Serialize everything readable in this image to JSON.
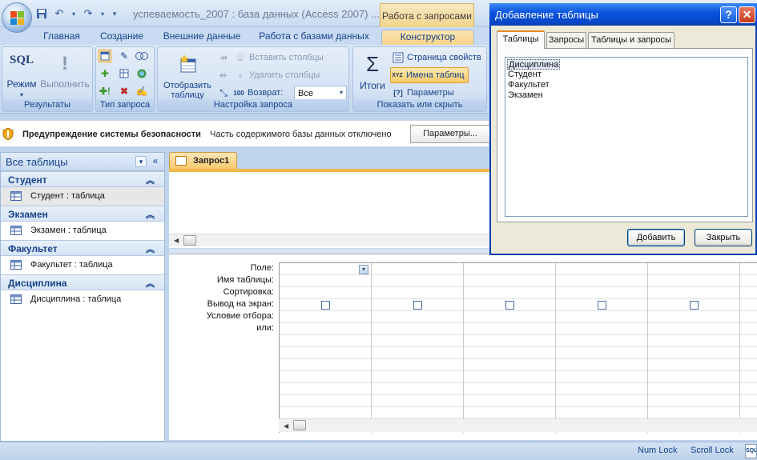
{
  "app": {
    "title": "успеваемость_2007 : база данных (Access 2007) ...!",
    "context_tab_header": "Работа с запросами"
  },
  "tabs": [
    {
      "label": "Главная"
    },
    {
      "label": "Создание"
    },
    {
      "label": "Внешние данные"
    },
    {
      "label": "Работа с базами данных"
    },
    {
      "label": "Конструктор",
      "active": true
    }
  ],
  "ribbon": {
    "results": {
      "label": "Результаты",
      "sql_icon_text": "SQL",
      "view": "Режим",
      "run": "Выполнить"
    },
    "query_type": {
      "label": "Тип запроса"
    },
    "query_setup": {
      "label": "Настройка запроса",
      "show_table": "Отобразить таблицу",
      "insert_columns": "Вставить столбцы",
      "delete_columns": "Удалить столбцы",
      "return_label": "Возврат:",
      "return_value": "Все"
    },
    "show_hide": {
      "label": "Показать или скрыть",
      "totals": "Итоги",
      "property_sheet": "Страница свойств",
      "table_names": "Имена таблиц",
      "parameters": "Параметры",
      "xyz": "XYZ"
    }
  },
  "security_bar": {
    "warning": "Предупреждение системы безопасности",
    "message": "Часть содержимого базы данных отключено",
    "button": "Параметры..."
  },
  "nav_pane": {
    "title": "Все таблицы",
    "groups": [
      {
        "name": "Студент",
        "items": [
          {
            "label": "Студент : таблица",
            "selected": true
          }
        ]
      },
      {
        "name": "Экзамен",
        "items": [
          {
            "label": "Экзамен : таблица"
          }
        ]
      },
      {
        "name": "Факультет",
        "items": [
          {
            "label": "Факультет : таблица"
          }
        ]
      },
      {
        "name": "Дисциплина",
        "items": [
          {
            "label": "Дисциплина : таблица"
          }
        ]
      }
    ]
  },
  "document": {
    "tab_label": "Запрос1",
    "grid_rows": [
      "Поле:",
      "Имя таблицы:",
      "Сортировка:",
      "Вывод на экран:",
      "Условие отбора:",
      "или:"
    ],
    "show_checkboxes": [
      false,
      false,
      false,
      false,
      false
    ]
  },
  "status_bar": {
    "num_lock": "Num Lock",
    "scroll_lock": "Scroll Lock",
    "sql_indicator": "SQL"
  },
  "dialog": {
    "title": "Добавление таблицы",
    "help_btn": "?",
    "tabs": [
      {
        "label": "Таблицы",
        "active": true
      },
      {
        "label": "Запросы"
      },
      {
        "label": "Таблицы и запросы"
      }
    ],
    "list": [
      "Дисциплина",
      "Студент",
      "Факультет",
      "Экзамен"
    ],
    "selected_index": 0,
    "add_button": "Добавить",
    "close_button": "Закрыть"
  },
  "colors": {
    "ribbon_blue": "#15428b",
    "context_orange": "#f6d48a",
    "dialog_title": "#0b55df"
  }
}
